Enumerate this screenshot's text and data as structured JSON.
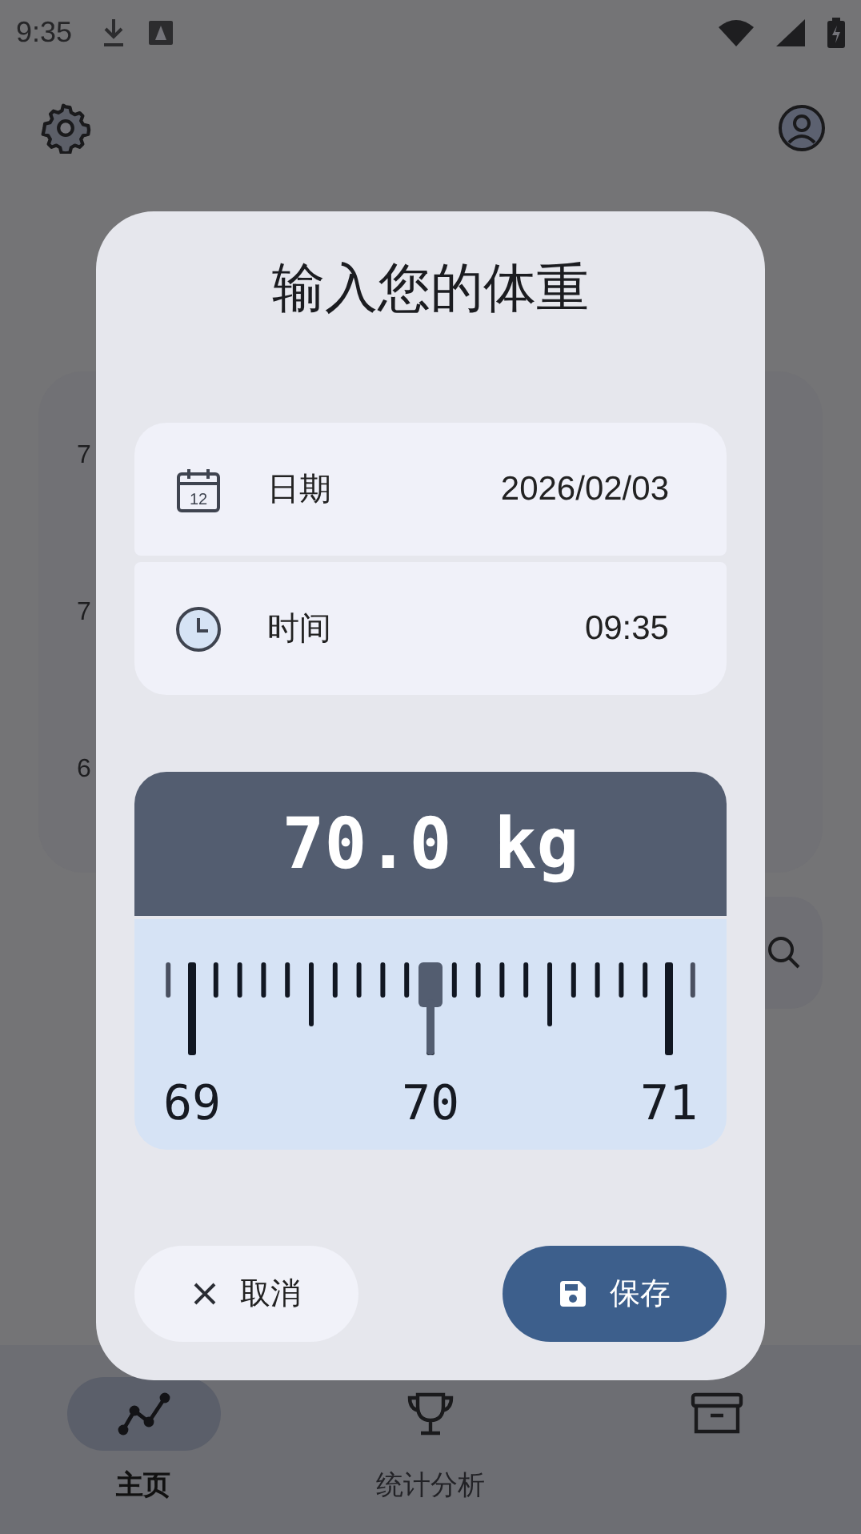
{
  "status_bar": {
    "time": "9:35"
  },
  "background": {
    "axis_labels": [
      "7",
      "7",
      "6"
    ]
  },
  "dialog": {
    "title": "输入您的体重",
    "date": {
      "label": "日期",
      "value": "2026/02/03",
      "calendar_day": "12"
    },
    "time": {
      "label": "时间",
      "value": "09:35"
    },
    "reading": "70.0 kg",
    "ruler": {
      "labels": [
        "69",
        "70",
        "71"
      ],
      "level": 0.5
    },
    "buttons": [
      {
        "kind": "cancel",
        "label": "取消"
      },
      {
        "kind": "save",
        "label": "保存"
      }
    ]
  },
  "nav": [
    {
      "kind": "chart",
      "label": "主页",
      "selected": true
    },
    {
      "kind": "trophy",
      "label": "统计分析",
      "selected": false
    },
    {
      "kind": "archive",
      "selected": false
    }
  ]
}
